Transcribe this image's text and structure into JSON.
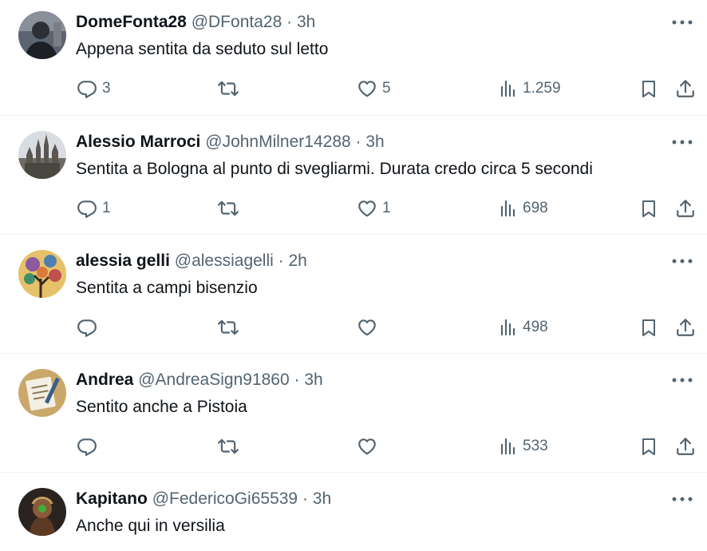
{
  "tweets": [
    {
      "name": "DomeFonta28",
      "handle": "@DFonta28",
      "dot": "·",
      "time": "3h",
      "text": "Appena sentita da seduto sul letto",
      "replies": "3",
      "retweets": "",
      "likes": "5",
      "views": "1.259",
      "avatar": "avatar-photo-person-dark"
    },
    {
      "name": "Alessio Marroci",
      "handle": "@JohnMilner14288",
      "dot": "·",
      "time": "3h",
      "text": "Sentita a Bologna al punto di svegliarmi. Durata credo circa 5 secondi",
      "replies": "1",
      "retweets": "",
      "likes": "1",
      "views": "698",
      "avatar": "avatar-photo-cathedral"
    },
    {
      "name": "alessia gelli",
      "handle": "@alessiagelli",
      "dot": "·",
      "time": "2h",
      "text": "Sentita a campi bisenzio",
      "replies": "",
      "retweets": "",
      "likes": "",
      "views": "498",
      "avatar": "avatar-illustration-tree"
    },
    {
      "name": "Andrea",
      "handle": "@AndreaSign91860",
      "dot": "·",
      "time": "3h",
      "text": "Sentito anche a Pistoia",
      "replies": "",
      "retweets": "",
      "likes": "",
      "views": "533",
      "avatar": "avatar-illustration-notebook"
    },
    {
      "name": "Kapitano",
      "handle": "@FedericoGi65539",
      "dot": "·",
      "time": "3h",
      "text": "Anche qui in versilia",
      "avatar": "avatar-illustration-warrior"
    }
  ],
  "colors": {
    "text_primary": "#0f1419",
    "text_secondary": "#536471",
    "divider": "#eff3f4",
    "background": "#ffffff"
  },
  "icons": [
    "reply-icon",
    "retweet-icon",
    "like-icon",
    "views-icon",
    "bookmark-icon",
    "share-icon",
    "more-icon"
  ]
}
